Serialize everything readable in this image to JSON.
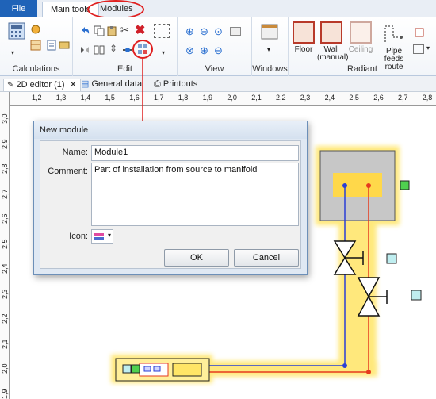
{
  "ribbon": {
    "tabs": {
      "file": "File",
      "main_tools": "Main tools",
      "modules": "Modules"
    },
    "groups": {
      "calculations": "Calculations",
      "edit": "Edit",
      "view": "View",
      "windows": "Windows",
      "radiant": "Radiant"
    },
    "buttons": {
      "floor": "Floor",
      "wall": "Wall",
      "wall_sub": "(manual)",
      "ceiling": "Ceiling",
      "pipe_feeds": "Pipe feeds",
      "pipe_feeds_sub": "route"
    }
  },
  "doc_tabs": {
    "editor": "2D editor (1)",
    "editor_close": "✕",
    "general": "General data",
    "printouts": "Printouts"
  },
  "rulers": {
    "horizontal": [
      "1,2",
      "1,3",
      "1,4",
      "1,5",
      "1,6",
      "1,7",
      "1,8",
      "1,9",
      "2,0",
      "2,1",
      "2,2",
      "2,3",
      "2,4",
      "2,5",
      "2,6",
      "2,7",
      "2,8"
    ],
    "vertical": [
      "3,0",
      "2,9",
      "2,8",
      "2,7",
      "2,6",
      "2,5",
      "2,4",
      "2,3",
      "2,2",
      "2,1",
      "2,0",
      "1,9"
    ]
  },
  "dialog": {
    "title": "New module",
    "name_label": "Name:",
    "name_value": "Module1",
    "comment_label": "Comment:",
    "comment_value": "Part of installation from source to manifold",
    "icon_label": "Icon:",
    "ok": "OK",
    "cancel": "Cancel"
  },
  "colors": {
    "ribbon_accent": "#1f63b8",
    "annotation_red": "#e02020",
    "pipe_supply": "#e63a1e",
    "pipe_return": "#2a3fd6",
    "highlight_glow": "#ffe566"
  }
}
